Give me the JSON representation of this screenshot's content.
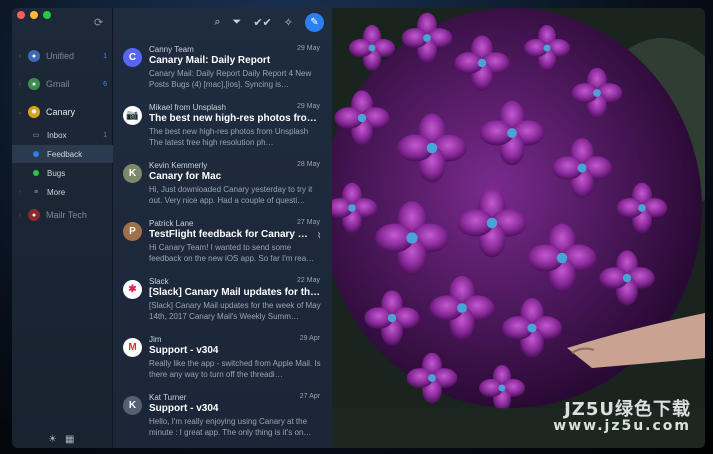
{
  "sidebar": {
    "accounts": [
      {
        "label": "Unified",
        "count": "1"
      },
      {
        "label": "Gmail",
        "count": "6"
      },
      {
        "label": "Canary",
        "count": ""
      },
      {
        "label": "Mailr Tech",
        "count": ""
      }
    ],
    "folders": [
      {
        "label": "Inbox",
        "count": "1",
        "icon": "inbox-icon"
      },
      {
        "label": "Feedback",
        "count": "",
        "color": "#2c7ff0"
      },
      {
        "label": "Bugs",
        "count": "",
        "color": "#28c840"
      },
      {
        "label": "More",
        "count": "",
        "icon": "hamburger-icon"
      }
    ]
  },
  "messages": [
    {
      "from": "Canny Team",
      "date": "29 May",
      "subject": "Canary Mail: Daily Report",
      "preview": "Canary Mail: Daily Report Daily Report 4 New Posts Bugs (4) [mac],[ios]. Syncing is…",
      "avatar": "C",
      "avatar_color": "#5865f2"
    },
    {
      "from": "Mikael from Unsplash",
      "date": "29 May",
      "subject": "The best new high-res photos from…",
      "preview": "The best new high-res photos from Unsplash The latest free high resolution ph…",
      "avatar": "📷",
      "avatar_color": "#ffffff"
    },
    {
      "from": "Kevin Kemmerly",
      "date": "28 May",
      "subject": "Canary for Mac",
      "preview": "Hi, Just downloaded Canary yesterday to try it out. Very nice app. Had a couple of questi…",
      "avatar": "K",
      "avatar_color": "#7a8a6a"
    },
    {
      "from": "Patrick Lane",
      "date": "27 May",
      "subject": "TestFlight feedback for Canary Mail.",
      "preview": "Hi Canary Team! I wanted to send some feedback on the new iOS app. So far I'm rea…",
      "avatar": "P",
      "avatar_color": "#a0704a"
    },
    {
      "from": "Slack",
      "date": "22 May",
      "subject": "[Slack] Canary Mail updates for the…",
      "preview": "[Slack] Canary Mail updates for the week of May 14th, 2017 Canary Mail's Weekly Summ…",
      "avatar": "✱",
      "avatar_color": "#ffffff"
    },
    {
      "from": "Jim",
      "date": "29 Apr",
      "subject": "Support - v304",
      "preview": "Really like the app - switched from Apple Mail. Is there any way to turn off the threadi…",
      "avatar": "M",
      "avatar_color": "#ffffff"
    },
    {
      "from": "Kat Turner",
      "date": "27 Apr",
      "subject": "Support - v304",
      "preview": "Hello, I'm really enjoying using Canary at the minute : I great app. The only thing is it's on…",
      "avatar": "K",
      "avatar_color": "#556070"
    }
  ],
  "watermark": {
    "line1": "JZ5U绿色下载",
    "line2": "www.jz5u.com"
  }
}
